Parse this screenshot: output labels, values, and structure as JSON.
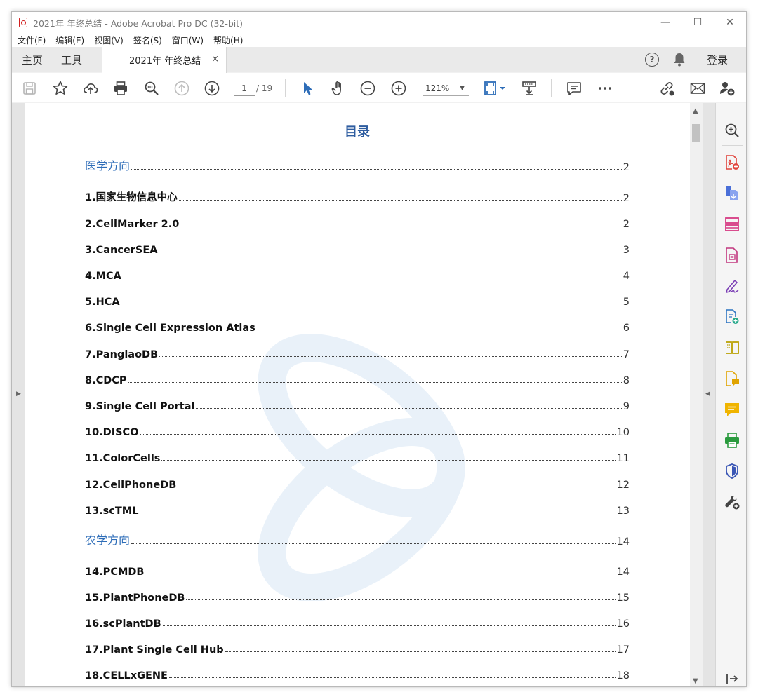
{
  "window": {
    "title": "2021年 年终总结 - Adobe Acrobat Pro DC (32-bit)",
    "controls": {
      "minimize": "—",
      "maximize": "☐",
      "close": "✕"
    }
  },
  "menu": [
    "文件(F)",
    "编辑(E)",
    "视图(V)",
    "签名(S)",
    "窗口(W)",
    "帮助(H)"
  ],
  "tabs": {
    "home": "主页",
    "tools": "工具",
    "document": "2021年 年终总结",
    "close": "×",
    "help": "?",
    "login": "登录"
  },
  "toolbar": {
    "page_current": "1",
    "page_total": "/ 19",
    "zoom": "121%",
    "icons": [
      "save-icon",
      "bookmark-star-icon",
      "cloud-upload-icon",
      "print-icon",
      "search-icon",
      "page-up-icon",
      "page-down-icon",
      "select-cursor-icon",
      "hand-icon",
      "zoom-out-icon",
      "zoom-in-icon",
      "fit-page-icon",
      "scroll-mode-icon",
      "comment-icon",
      "more-icon",
      "share-link-icon",
      "email-icon",
      "add-user-icon"
    ]
  },
  "document": {
    "toc_title": "目录",
    "entries": [
      {
        "label": "医学方向",
        "page": "2",
        "kind": "section"
      },
      {
        "label": "1.国家生物信息中心",
        "page": "2",
        "kind": "item"
      },
      {
        "label": "2.CellMarker 2.0",
        "page": "2",
        "kind": "item"
      },
      {
        "label": "3.CancerSEA",
        "page": "3",
        "kind": "item"
      },
      {
        "label": "4.MCA",
        "page": "4",
        "kind": "item"
      },
      {
        "label": "5.HCA",
        "page": "5",
        "kind": "item"
      },
      {
        "label": "6.Single Cell Expression Atlas",
        "page": "6",
        "kind": "item"
      },
      {
        "label": "7.PanglaoDB",
        "page": "7",
        "kind": "item"
      },
      {
        "label": "8.CDCP",
        "page": "8",
        "kind": "item"
      },
      {
        "label": "9.Single Cell Portal",
        "page": "9",
        "kind": "item"
      },
      {
        "label": "10.DISCO",
        "page": "10",
        "kind": "item"
      },
      {
        "label": "11.ColorCells",
        "page": "11",
        "kind": "item"
      },
      {
        "label": "12.CellPhoneDB",
        "page": "12",
        "kind": "item"
      },
      {
        "label": "13.scTML",
        "page": "13",
        "kind": "item"
      },
      {
        "label": "农学方向",
        "page": "14",
        "kind": "section"
      },
      {
        "label": "14.PCMDB",
        "page": "14",
        "kind": "item"
      },
      {
        "label": "15.PlantPhoneDB",
        "page": "15",
        "kind": "item"
      },
      {
        "label": "16.scPlantDB",
        "page": "16",
        "kind": "item"
      },
      {
        "label": "17.Plant Single Cell Hub",
        "page": "17",
        "kind": "item"
      },
      {
        "label": "18.CELLxGENE",
        "page": "18",
        "kind": "item"
      }
    ]
  },
  "right_panel": {
    "icons": [
      "zoom-search-icon",
      "create-pdf-icon",
      "export-pdf-icon",
      "organize-pages-icon",
      "edit-pdf-icon",
      "fill-sign-icon",
      "combine-files-icon",
      "compare-files-icon",
      "send-for-comments-icon",
      "comment-tool-icon",
      "print-production-icon",
      "protect-icon",
      "more-tools-icon",
      "collapse-panel-icon"
    ]
  },
  "colors": {
    "accent": "#2e6db8",
    "heading": "#2e5da0",
    "pdf_red": "#d21f1f"
  }
}
